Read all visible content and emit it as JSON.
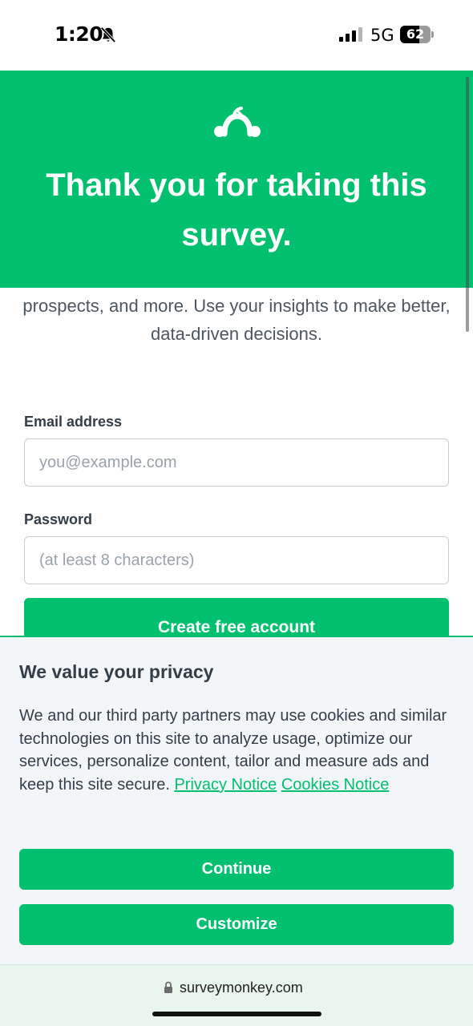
{
  "status_bar": {
    "time": "1:20",
    "network": "5G",
    "battery": "62",
    "battery_level": 0.62,
    "icons": [
      "bell-slash-icon",
      "signal-icon",
      "battery-icon"
    ]
  },
  "header": {
    "logo_icon": "surveymonkey-logo-icon",
    "title": "Thank you for taking this survey.",
    "background_color": "#00bf6f"
  },
  "intro": {
    "text": "prospects, and more. Use your insights to make better, data-driven decisions."
  },
  "form": {
    "email_label": "Email address",
    "email_placeholder": "you@example.com",
    "email_value": "",
    "password_label": "Password",
    "password_placeholder": "(at least 8 characters)",
    "password_value": "",
    "submit_label": "Create free account"
  },
  "privacy": {
    "title": "We value your privacy",
    "body": "We and our third party partners may use cookies and similar technologies on this site to analyze usage, optimize our services, personalize content, tailor and measure ads and keep this site secure.",
    "privacy_notice_link": "Privacy Notice",
    "cookies_notice_link": "Cookies Notice",
    "continue_label": "Continue",
    "customize_label": "Customize",
    "accent_color": "#00bf6f"
  },
  "browser": {
    "url": "surveymonkey.com",
    "lock_icon": "lock-icon"
  }
}
